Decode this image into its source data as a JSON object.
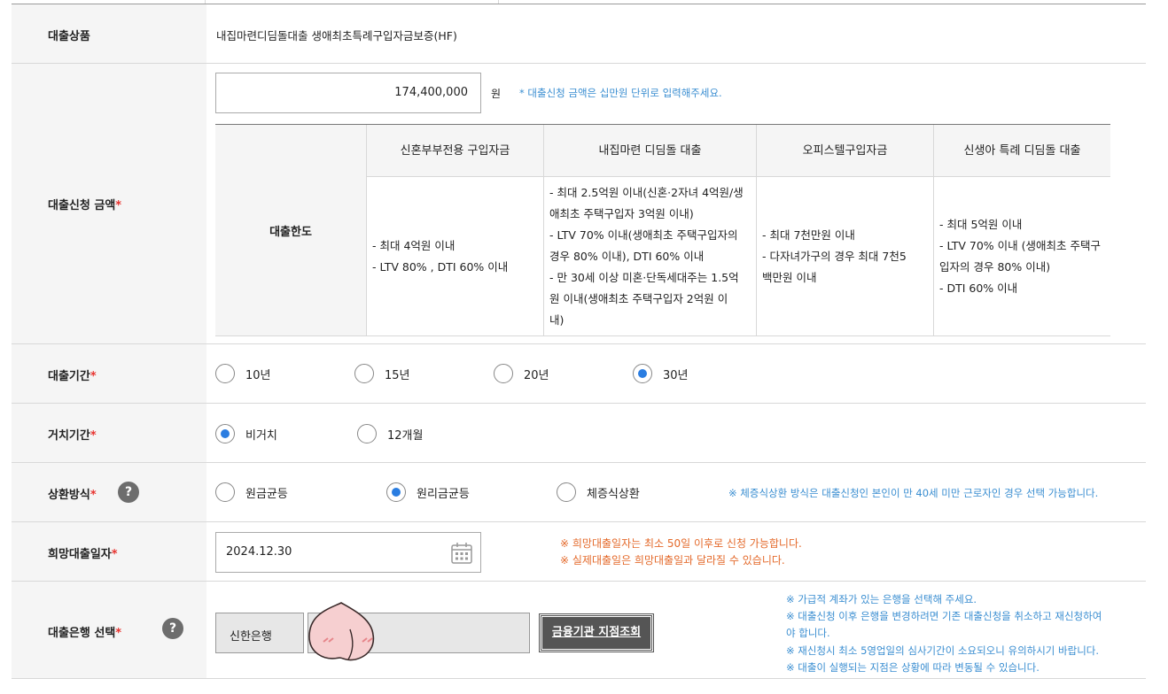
{
  "loan_product": {
    "label": "대출상품",
    "value": "내집마련디딤돌대출 생애최초특례구입자금보증(HF)"
  },
  "loan_amount": {
    "label": "대출신청 금액",
    "required_mark": "*",
    "value": "174,400,000",
    "unit": "원",
    "note": "* 대출신청 금액은 십만원 단위로 입력해주세요.",
    "limit_table": {
      "row_header": "대출한도",
      "columns": [
        {
          "header": "신혼부부전용 구입자금",
          "lines": [
            "- 최대 4억원 이내",
            "- LTV 80% , DTI 60% 이내"
          ]
        },
        {
          "header": "내집마련 디딤돌 대출",
          "lines": [
            "- 최대 2.5억원 이내(신혼·2자녀 4억원/생",
            "애최초 주택구입자 3억원 이내)",
            "- LTV 70% 이내(생애최초 주택구입자의",
            "경우 80% 이내), DTI 60% 이내",
            "- 만 30세 이상 미혼·단독세대주는 1.5억",
            "원 이내(생애최초 주택구입자 2억원 이",
            "내)"
          ]
        },
        {
          "header": "오피스텔구입자금",
          "lines": [
            "- 최대 7천만원 이내",
            "- 다자녀가구의 경우 최대 7천5",
            "백만원 이내"
          ]
        },
        {
          "header": "신생아 특례 디딤돌 대출",
          "lines": [
            "- 최대 5억원 이내",
            "- LTV 70% 이내 (생애최초 주택구",
            "입자의 경우 80% 이내)",
            "- DTI 60% 이내"
          ]
        }
      ]
    }
  },
  "loan_period": {
    "label": "대출기간",
    "required_mark": "*",
    "options": [
      {
        "label": "10년",
        "selected": false
      },
      {
        "label": "15년",
        "selected": false
      },
      {
        "label": "20년",
        "selected": false
      },
      {
        "label": "30년",
        "selected": true
      }
    ]
  },
  "grace_period": {
    "label": "거치기간",
    "required_mark": "*",
    "options": [
      {
        "label": "비거치",
        "selected": true
      },
      {
        "label": "12개월",
        "selected": false
      }
    ]
  },
  "repayment": {
    "label": "상환방식",
    "required_mark": "*",
    "help": "?",
    "options": [
      {
        "label": "원금균등",
        "selected": false
      },
      {
        "label": "원리금균등",
        "selected": true
      },
      {
        "label": "체증식상환",
        "selected": false
      }
    ],
    "note": "※ 체증식상환 방식은 대출신청인 본인이 만 40세 미만 근로자인 경우 선택 가능합니다."
  },
  "desired_date": {
    "label": "희망대출일자",
    "required_mark": "*",
    "value": "2024.12.30",
    "notes": [
      "※ 희망대출일자는 최소 50일 이후로 신청 가능합니다.",
      "※ 실제대출일은 희망대출일과 달라질 수 있습니다."
    ]
  },
  "bank": {
    "label": "대출은행 선택",
    "required_mark": "*",
    "help": "?",
    "bank_name": "신한은행",
    "branch_button": "금융기관 지점조회",
    "notes": [
      "※ 가급적 계좌가 있는 은행을 선택해 주세요.",
      "※ 대출신청 이후 은행을 변경하려면 기존 대출신청을 취소하고 재신청하여",
      "야 합니다.",
      "※ 재신청시 최소 5영업일의 심사기간이 소요되오니 유의하시기 바랍니다.",
      "※ 대출이 실행되는 지점은 상황에 따라 변동될 수 있습니다."
    ]
  },
  "colors": {
    "accent": "#2a7de1",
    "note_blue": "#3a8ed1",
    "note_orange": "#e46a2b",
    "required": "#e8332f"
  }
}
